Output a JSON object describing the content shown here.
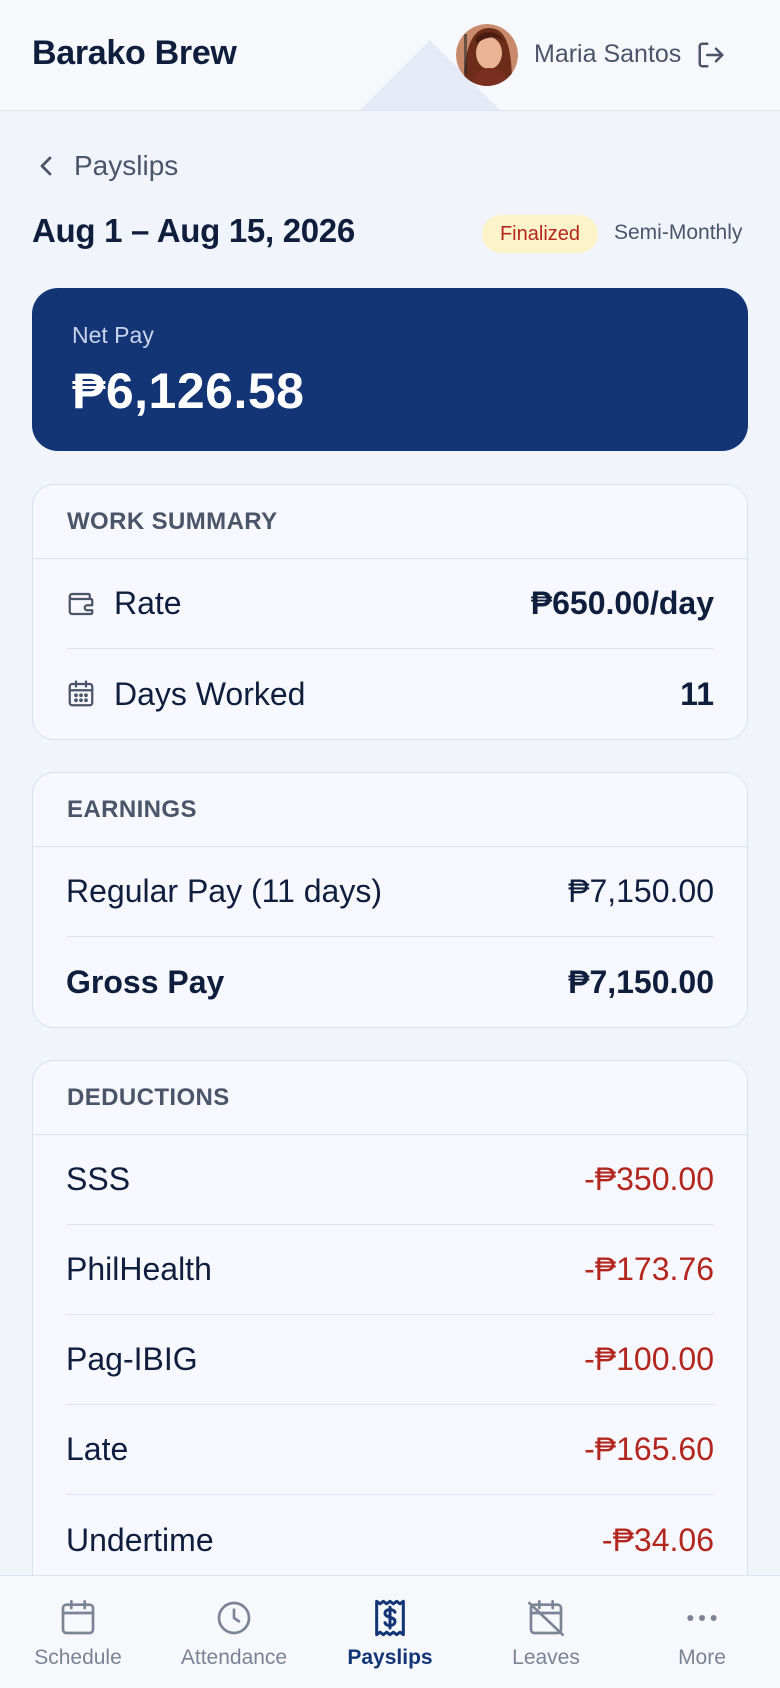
{
  "header": {
    "brand": "Barako Brew",
    "user_name": "Maria Santos",
    "icons": {
      "avatar": "user-avatar-photo",
      "logout": "logout-icon"
    }
  },
  "page": {
    "back_label": "Payslips",
    "period": "Aug 1 – Aug 15, 2026",
    "status_badge": "Finalized",
    "frequency": "Semi-Monthly"
  },
  "net_pay": {
    "label": "Net Pay",
    "value": "₱6,126.58"
  },
  "work_summary": {
    "title": "WORK SUMMARY",
    "rows": [
      {
        "icon": "wallet-icon",
        "label": "Rate",
        "value": "₱650.00/day"
      },
      {
        "icon": "calendar-icon",
        "label": "Days Worked",
        "value": "11"
      }
    ]
  },
  "earnings": {
    "title": "EARNINGS",
    "rows": [
      {
        "label": "Regular Pay (11 days)",
        "value": "₱7,150.00"
      },
      {
        "label": "Gross Pay",
        "value": "₱7,150.00"
      }
    ]
  },
  "deductions": {
    "title": "DEDUCTIONS",
    "rows": [
      {
        "label": "SSS",
        "value": "-₱350.00"
      },
      {
        "label": "PhilHealth",
        "value": "-₱173.76"
      },
      {
        "label": "Pag-IBIG",
        "value": "-₱100.00"
      },
      {
        "label": "Late",
        "value": "-₱165.60"
      },
      {
        "label": "Undertime",
        "value": "-₱34.06"
      }
    ]
  },
  "bottom_nav": {
    "items": [
      {
        "label": "Schedule",
        "icon": "calendar-icon"
      },
      {
        "label": "Attendance",
        "icon": "clock-icon"
      },
      {
        "label": "Payslips",
        "icon": "payslip-icon",
        "active": true
      },
      {
        "label": "Leaves",
        "icon": "calendar-off-icon"
      },
      {
        "label": "More",
        "icon": "more-dots-icon"
      }
    ]
  },
  "colors": {
    "primary": "#133575",
    "negative": "#b3261e",
    "badge_bg": "#fdf3c8",
    "background": "#f1f5fb"
  }
}
